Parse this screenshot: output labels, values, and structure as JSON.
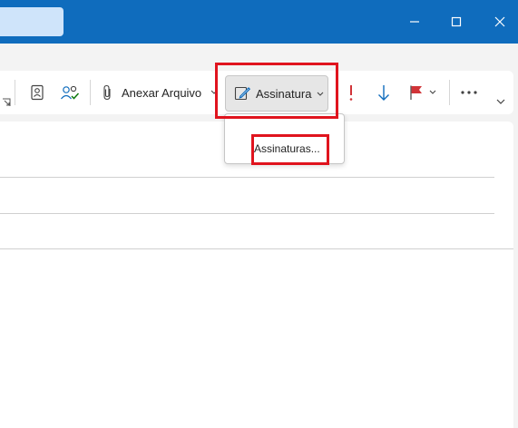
{
  "ribbon": {
    "attach_label": "Anexar Arquivo",
    "signature_label": "Assinatura"
  },
  "signature_menu": {
    "items": [
      {
        "label": "Assinaturas..."
      }
    ]
  },
  "colors": {
    "titlebar": "#0f6cbd",
    "highlight": "#e0141e",
    "importance_high": "#d13438",
    "importance_low": "#0f6cbd",
    "flag": "#d13438"
  }
}
